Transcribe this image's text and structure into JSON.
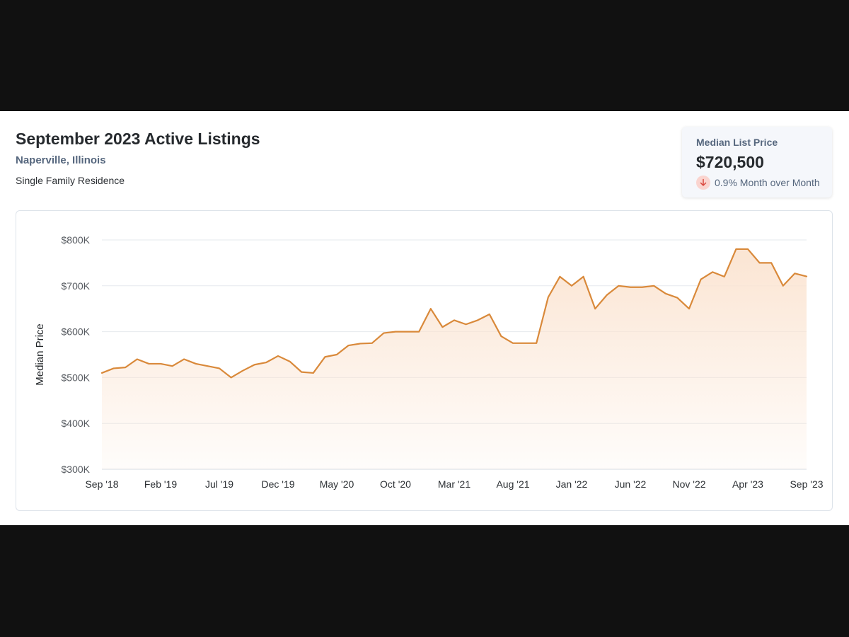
{
  "header": {
    "title": "September 2023 Active Listings",
    "location": "Naperville, Illinois",
    "property_type": "Single Family Residence"
  },
  "stat": {
    "label": "Median List Price",
    "value": "$720,500",
    "change": "0.9% Month over Month",
    "direction_icon": "arrow-down-icon"
  },
  "colors": {
    "line": "#d9893a",
    "fill": "#fbe5d3",
    "decrease_badge": "#fad4cf",
    "decrease_arrow": "#d9463d"
  },
  "chart_data": {
    "type": "area",
    "title": "",
    "xlabel": "",
    "ylabel": "Median Price",
    "ylim": [
      300000,
      800000
    ],
    "yticks": [
      300000,
      400000,
      500000,
      600000,
      700000,
      800000
    ],
    "ytick_labels": [
      "$300K",
      "$400K",
      "$500K",
      "$600K",
      "$700K",
      "$800K"
    ],
    "xtick_labels": [
      "Sep '18",
      "Feb '19",
      "Jul '19",
      "Dec '19",
      "May '20",
      "Oct '20",
      "Mar '21",
      "Aug '21",
      "Jan '22",
      "Jun '22",
      "Nov '22",
      "Apr '23",
      "Sep '23"
    ],
    "xtick_interval_months": 5,
    "grid": true,
    "series": [
      {
        "values": [
          510000,
          520000,
          522000,
          540000,
          530000,
          530000,
          525000,
          540000,
          530000,
          525000,
          520000,
          500000,
          515000,
          528000,
          533000,
          547000,
          535000,
          512000,
          510000,
          545000,
          550000,
          570000,
          574000,
          575000,
          597000,
          600000,
          600000,
          600000,
          650000,
          610000,
          625000,
          616000,
          625000,
          638000,
          590000,
          575000,
          575000,
          575000,
          675000,
          720000,
          700000,
          720000,
          650000,
          680000,
          700000,
          697000,
          697000,
          700000,
          683000,
          674000,
          650000,
          714000,
          730000,
          720000,
          780000,
          780000,
          750000,
          750000,
          700000,
          727000,
          720500
        ]
      }
    ]
  }
}
